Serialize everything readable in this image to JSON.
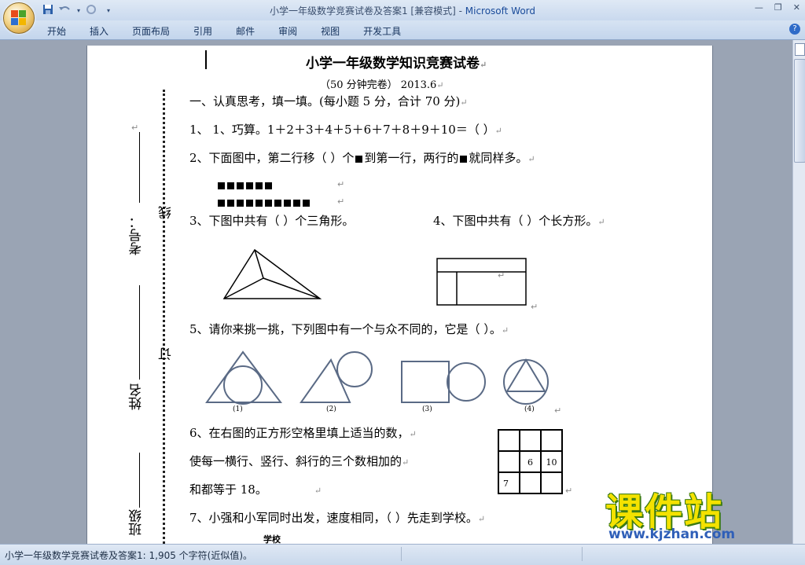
{
  "window": {
    "title": "小学一年级数学竞赛试卷及答案1 [兼容模式] - ",
    "app_name": "Microsoft Word"
  },
  "ribbon": {
    "tabs": [
      "开始",
      "插入",
      "页面布局",
      "引用",
      "邮件",
      "审阅",
      "视图",
      "开发工具"
    ]
  },
  "doc": {
    "title": "小学一年级数学知识竞赛试卷",
    "subtitle": "（50 分钟完卷）  2013.6",
    "section1": "一、认真思考，填一填。(每小题 5 分，合计 70 分)",
    "q1": "1、 1、巧算。1＋2＋3＋4＋5＋6＋7＋8＋9＋10＝（          ）",
    "q2_a": "2、下面图中，第二行移（     ）个",
    "q2_b": "到第一行，两行的",
    "q2_c": "就同样多。",
    "row1_count": 6,
    "row2_count": 10,
    "q3": "3、下图中共有（     ）个三角形。",
    "q4": "4、下图中共有（     ）个长方形。",
    "q5": "5、请你来挑一挑，下列图中有一个与众不同的，它是（       ）。",
    "shape_labels": [
      "(1)",
      "(2)",
      "(3)",
      "(4)"
    ],
    "q6_line1": "6、在右图的正方形空格里填上适当的数，",
    "q6_line2": "使每一横行、竖行、斜行的三个数相加的",
    "q6_line3": "和都等于 18。",
    "grid": [
      [
        "",
        "",
        ""
      ],
      [
        "",
        "6",
        "10"
      ],
      [
        "7",
        "",
        ""
      ]
    ],
    "q7": "7、小强和小军同时出发，速度相同，（         ）先走到学校。",
    "school_label": "学校",
    "margin_labels": {
      "kaohao": "考号：",
      "xingming": "姓名",
      "banji": "班级",
      "xian": "线",
      "ding": "订"
    }
  },
  "status": {
    "text": "小学一年级数学竞赛试卷及答案1: 1,905 个字符(近似值)。"
  },
  "watermark": {
    "brand": "课件站",
    "url": "www.kjzhan.com"
  },
  "colors": {
    "title_bar": "#dfe9f5",
    "ribbon": "#c3d5ec",
    "workspace": "#9aa4b4",
    "watermark_yellow": "#f4e200",
    "watermark_blue": "#2f5fb8"
  }
}
